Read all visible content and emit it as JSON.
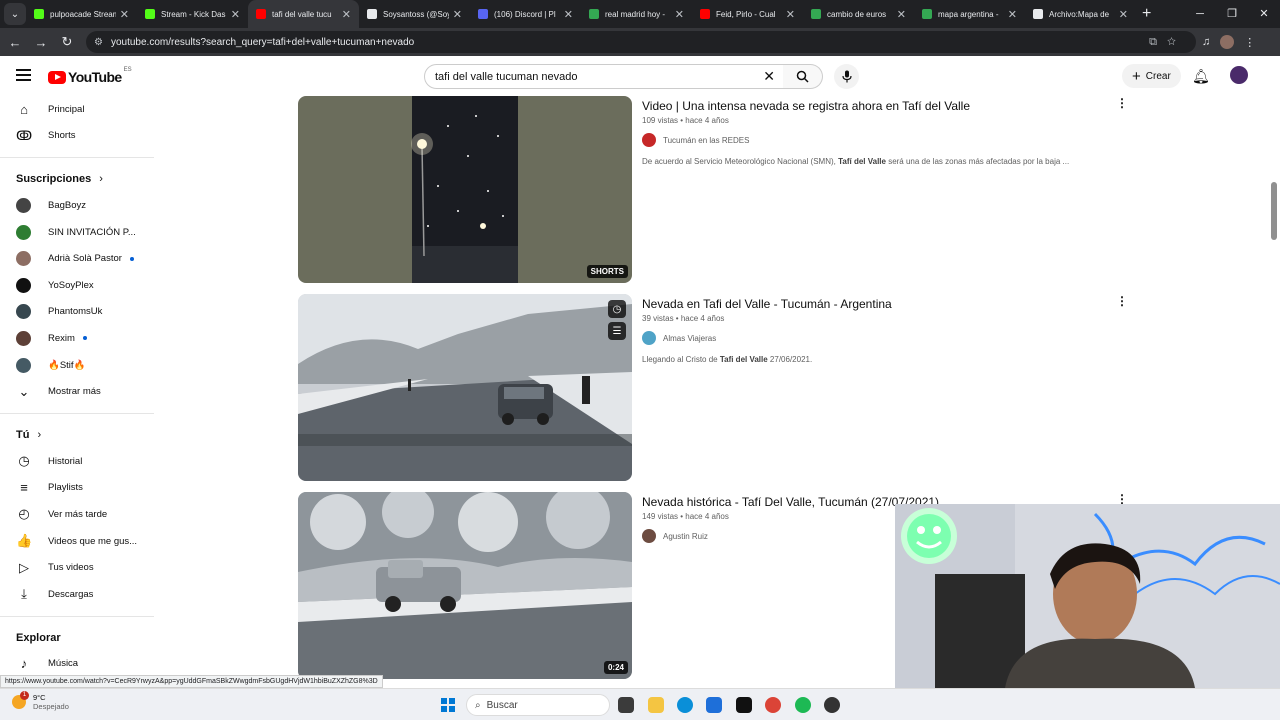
{
  "browser": {
    "tabs": [
      {
        "title": "pulpoacade Stream",
        "color": "#53fc18",
        "active": false
      },
      {
        "title": "Stream - Kick Das",
        "color": "#53fc18",
        "active": false
      },
      {
        "title": "tafi del valle tucu",
        "color": "#ff0000",
        "active": true
      },
      {
        "title": "Soysantoss (@Soy",
        "color": "#e8eaed",
        "active": false
      },
      {
        "title": "(106) Discord | Pl",
        "color": "#5865f2",
        "active": false
      },
      {
        "title": "real madrid hoy -",
        "color": "#34a853",
        "active": false
      },
      {
        "title": "Feid, Pirlo - Cual",
        "color": "#ff0000",
        "active": false
      },
      {
        "title": "cambio de euros",
        "color": "#34a853",
        "active": false
      },
      {
        "title": "mapa argentina -",
        "color": "#34a853",
        "active": false
      },
      {
        "title": "Archivo:Mapa de",
        "color": "#e8eaed",
        "active": false
      }
    ],
    "url": "youtube.com/results?search_query=tafi+del+valle+tucuman+nevado",
    "status_url": "https://www.youtube.com/watch?v=CecR9YrwyzA&pp=ygUddGFmaSBkZWwgdmFsbGUgdHVjdW1hbiBuZXZhZG8%3D"
  },
  "masthead": {
    "logo_text": "YouTube",
    "country_code": "ES",
    "search_value": "tafi del valle tucuman nevado",
    "create_label": "Crear"
  },
  "sidebar": {
    "main": [
      {
        "label": "Principal",
        "icon": "home-icon",
        "glyph": "⌂"
      },
      {
        "label": "Shorts",
        "icon": "shorts-icon",
        "glyph": "ↂ"
      }
    ],
    "subs_header": "Suscripciones",
    "subscriptions": [
      {
        "label": "BagBoyz",
        "color": "#444444",
        "dot": false
      },
      {
        "label": "SIN INVITACIÓN P...",
        "color": "#2e7d32",
        "dot": false
      },
      {
        "label": "Adrià Solà Pastor",
        "color": "#8d6e63",
        "dot": true
      },
      {
        "label": "YoSoyPlex",
        "color": "#111111",
        "dot": false
      },
      {
        "label": "PhantomsUk",
        "color": "#37474f",
        "dot": false
      },
      {
        "label": "Rexim",
        "color": "#5d4037",
        "dot": true
      },
      {
        "label": "🔥Stif🔥",
        "color": "#455a64",
        "dot": false
      }
    ],
    "show_more": "Mostrar más",
    "you_header": "Tú",
    "you_items": [
      {
        "label": "Historial",
        "icon": "history-icon",
        "glyph": "◷"
      },
      {
        "label": "Playlists",
        "icon": "playlists-icon",
        "glyph": "≡"
      },
      {
        "label": "Ver más tarde",
        "icon": "watch-later-icon",
        "glyph": "◴"
      },
      {
        "label": "Videos que me gus...",
        "icon": "like-icon",
        "glyph": "👍"
      },
      {
        "label": "Tus videos",
        "icon": "your-videos-icon",
        "glyph": "▷"
      },
      {
        "label": "Descargas",
        "icon": "download-icon",
        "glyph": "⤓"
      }
    ],
    "explore_header": "Explorar",
    "explore_items": [
      {
        "label": "Música",
        "icon": "music-icon",
        "glyph": "♪"
      }
    ]
  },
  "results": [
    {
      "title": "Video | Una intensa nevada se registra ahora en Tafí del Valle",
      "views": "109 vistas",
      "age": "hace 4 años",
      "channel": "Tucumán en las REDES",
      "channel_color": "#c62828",
      "desc_before": "De acuerdo al Servicio Meteorológico Nacional (SMN), ",
      "desc_bold": "Tafí del Valle",
      "desc_after": " será una de las zonas más afectadas por la baja ...",
      "badge": "SHORTS"
    },
    {
      "title": "Nevada en Tafi del Valle - Tucumán - Argentina",
      "views": "39 vistas",
      "age": "hace 4 años",
      "channel": "Almas Viajeras",
      "channel_color": "#4fa3c7",
      "desc_before": "Llegando al Cristo de ",
      "desc_bold": "Tafi del Valle",
      "desc_after": " 27/06/2021.",
      "badge": ""
    },
    {
      "title": "Nevada histórica - Tafí Del Valle, Tucumán (27/07/2021)",
      "views": "149 vistas",
      "age": "hace 4 años",
      "channel": "Agustin Ruiz",
      "channel_color": "#6d4c41",
      "desc_before": "",
      "desc_bold": "",
      "desc_after": "",
      "badge": "0:24"
    }
  ],
  "taskbar": {
    "temperature": "9°C",
    "weather": "Despejado",
    "weather_badge": "1",
    "search_placeholder": "Buscar"
  }
}
